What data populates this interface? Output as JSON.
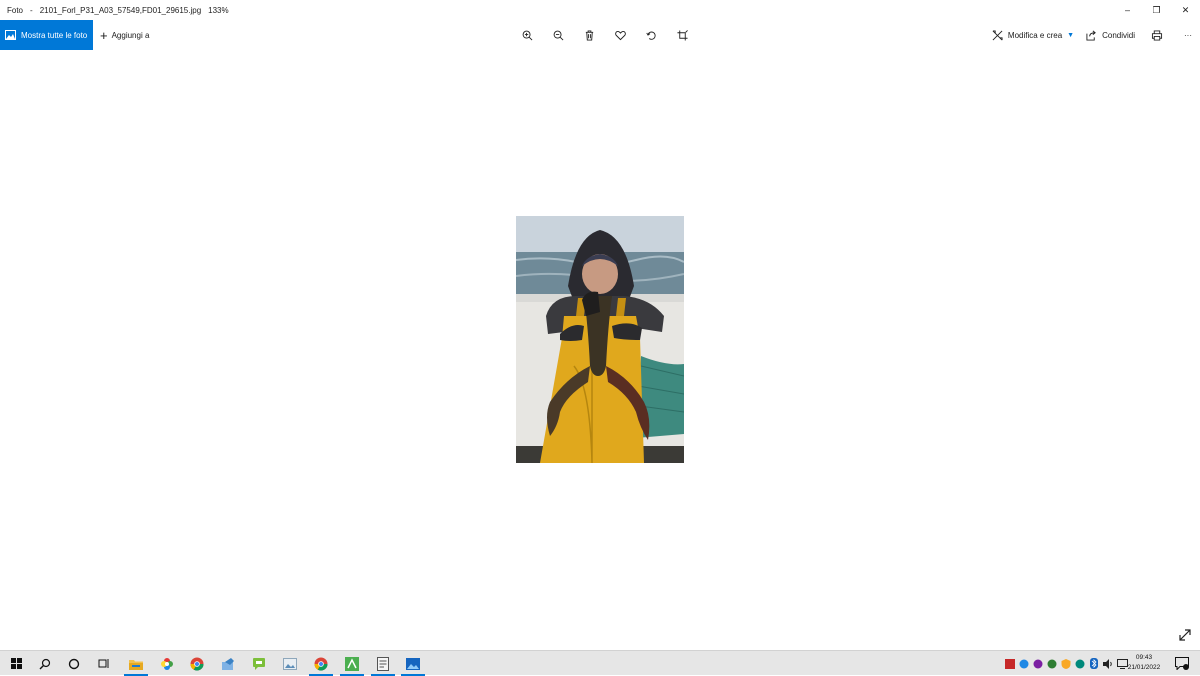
{
  "window": {
    "app_name": "Foto",
    "separator": "-",
    "file_name": "2101_Forl_P31_A03_57549,FD01_29615.jpg",
    "zoom": "133%",
    "controls": {
      "minimize": "–",
      "restore": "❐",
      "close": "✕"
    }
  },
  "toolbar": {
    "show_all_label": "Mostra tutte le foto",
    "add_to_label": "Aggiungi a",
    "center_tools": [
      "zoom-in-icon",
      "zoom-out-icon",
      "delete-icon",
      "favorite-icon",
      "rotate-icon",
      "crop-icon"
    ],
    "edit_label": "Modifica e crea",
    "share_label": "Condividi",
    "more_label": "···",
    "accent_color": "#0078d7"
  },
  "photo": {
    "subject": "photo-image"
  },
  "taskbar": {
    "clock_time": "09:43",
    "clock_date": "21/01/2022",
    "notification_count": "1"
  }
}
